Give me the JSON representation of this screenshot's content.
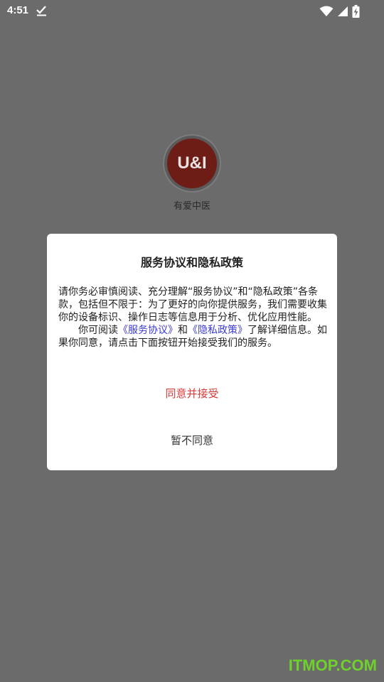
{
  "status_bar": {
    "time": "4:51",
    "icons": [
      "download-done-icon",
      "wifi-icon",
      "cell-signal-icon",
      "battery-charging-icon"
    ]
  },
  "app": {
    "logo_text": "U&I",
    "name": "有爱中医",
    "logo_color": "#6e1c16"
  },
  "dialog": {
    "title": "服务协议和隐私政策",
    "body_p1": "请你务必审慎阅读、充分理解“服务协议”和“隐私政策”各条款，包括但不限于：为了更好的向你提供服务，我们需要收集你的设备标识、操作日志等信息用于分析、优化应用性能。",
    "body_p2_prefix": "你可阅读",
    "service_link": "《服务协议》",
    "and_text": "和",
    "privacy_link": "《隐私政策》",
    "body_p2_suffix": "了解详细信息。如果你同意，请点击下面按钮开始接受我们的服务。",
    "agree_button": "同意并接受",
    "decline_button": "暂不同意",
    "link_color": "#3a3ad6",
    "agree_color": "#d43b3b"
  },
  "watermark": "ITMOP.COM"
}
